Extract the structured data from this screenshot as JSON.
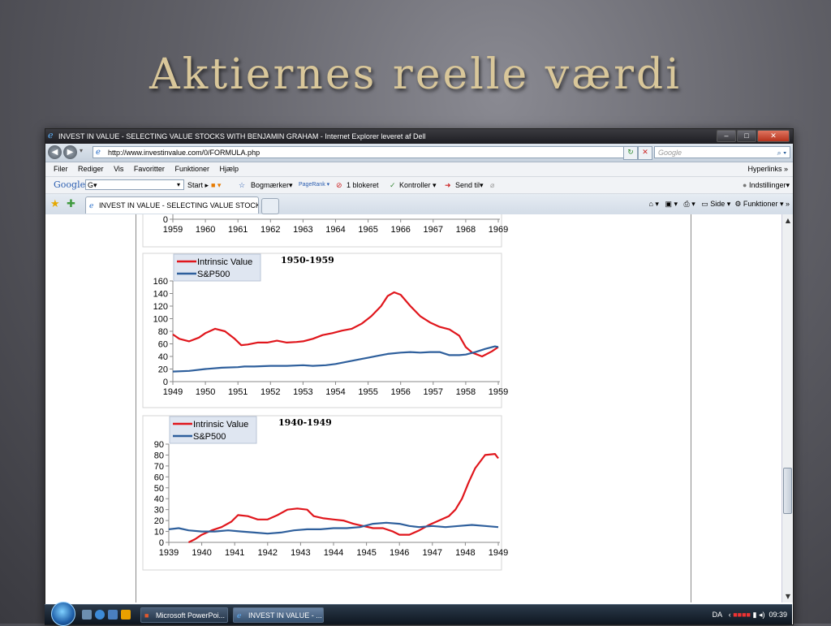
{
  "slide": {
    "title": "Aktiernes reelle værdi"
  },
  "browser": {
    "title": "INVEST IN VALUE - SELECTING VALUE STOCKS WITH BENJAMIN GRAHAM - Internet Explorer leveret af Dell",
    "url": "http://www.investinvalue.com/0/FORMULA.php",
    "search_placeholder": "Google",
    "menu": [
      "Filer",
      "Rediger",
      "Vis",
      "Favoritter",
      "Funktioner",
      "Hjælp"
    ],
    "hyperlinks": "Hyperlinks",
    "google_toolbar": {
      "brand": "Google",
      "box": "G▾",
      "start": "Start",
      "bookmarks": "Bogmærker▾",
      "pagerank": "PageRank",
      "blocked": "1 blokeret",
      "controls": "Kontroller",
      "send": "Send til▾",
      "settings": "Indstillinger▾"
    },
    "tab_label": "INVEST IN VALUE - SELECTING VALUE STOCKS W...",
    "command_bar": {
      "page": "Side",
      "tools": "Funktioner"
    }
  },
  "chart_data": [
    {
      "type": "line",
      "title": "",
      "x_tick_labels": [
        "1959",
        "1960",
        "1961",
        "1962",
        "1963",
        "1964",
        "1965",
        "1966",
        "1967",
        "1968",
        "1969"
      ],
      "y_tick_labels": [
        "0"
      ],
      "note": "partially visible, scrolled off top"
    },
    {
      "type": "line",
      "title": "1950-1959",
      "ylim": [
        0,
        160
      ],
      "y_ticks": [
        0,
        20,
        40,
        60,
        80,
        100,
        120,
        140,
        160
      ],
      "x_tick_labels": [
        "1949",
        "1950",
        "1951",
        "1952",
        "1953",
        "1954",
        "1955",
        "1956",
        "1957",
        "1958",
        "1959"
      ],
      "legend_position": "top-left",
      "series": [
        {
          "name": "Intrinsic Value",
          "color": "#e0161c",
          "x": [
            1949.0,
            1949.2,
            1949.5,
            1949.8,
            1950.0,
            1950.3,
            1950.6,
            1950.9,
            1951.1,
            1951.3,
            1951.6,
            1951.9,
            1952.2,
            1952.5,
            1952.8,
            1953.0,
            1953.3,
            1953.6,
            1953.9,
            1954.2,
            1954.5,
            1954.8,
            1955.1,
            1955.4,
            1955.6,
            1955.8,
            1956.0,
            1956.3,
            1956.6,
            1956.9,
            1957.2,
            1957.5,
            1957.8,
            1958.0,
            1958.2,
            1958.5,
            1958.8,
            1959.0
          ],
          "y": [
            75,
            68,
            64,
            70,
            77,
            84,
            80,
            68,
            58,
            59,
            62,
            62,
            65,
            62,
            63,
            64,
            68,
            74,
            77,
            81,
            84,
            92,
            104,
            120,
            136,
            142,
            138,
            120,
            104,
            94,
            87,
            83,
            73,
            55,
            46,
            40,
            48,
            55
          ]
        },
        {
          "name": "S&P500",
          "color": "#2e5f9c",
          "x": [
            1949.0,
            1949.5,
            1950.0,
            1950.5,
            1951.0,
            1951.2,
            1951.5,
            1952.0,
            1952.5,
            1953.0,
            1953.3,
            1953.7,
            1954.0,
            1954.4,
            1954.8,
            1955.0,
            1955.3,
            1955.6,
            1956.0,
            1956.3,
            1956.6,
            1956.9,
            1957.2,
            1957.5,
            1957.8,
            1958.0,
            1958.3,
            1958.6,
            1958.9,
            1959.0
          ],
          "y": [
            16,
            17,
            20,
            22,
            23,
            24,
            24,
            25,
            25,
            26,
            25,
            26,
            28,
            32,
            36,
            38,
            41,
            44,
            46,
            47,
            46,
            47,
            47,
            42,
            42,
            43,
            47,
            52,
            56,
            55
          ]
        }
      ]
    },
    {
      "type": "line",
      "title": "1940-1949",
      "ylim": [
        0,
        90
      ],
      "y_ticks": [
        0,
        10,
        20,
        30,
        40,
        50,
        60,
        70,
        80,
        90
      ],
      "x_tick_labels": [
        "1939",
        "1940",
        "1941",
        "1942",
        "1943",
        "1944",
        "1945",
        "1946",
        "1947",
        "1948",
        "1949"
      ],
      "legend_position": "top-left",
      "series": [
        {
          "name": "Intrinsic Value",
          "color": "#e0161c",
          "x": [
            1939.6,
            1939.8,
            1940.0,
            1940.3,
            1940.6,
            1940.9,
            1941.1,
            1941.4,
            1941.7,
            1942.0,
            1942.3,
            1942.6,
            1942.9,
            1943.2,
            1943.4,
            1943.7,
            1944.0,
            1944.3,
            1944.6,
            1944.9,
            1945.2,
            1945.5,
            1945.8,
            1946.0,
            1946.3,
            1946.6,
            1946.9,
            1947.2,
            1947.5,
            1947.7,
            1947.9,
            1948.1,
            1948.3,
            1948.6,
            1948.9,
            1949.0
          ],
          "y": [
            0,
            3,
            7,
            11,
            14,
            19,
            25,
            24,
            21,
            21,
            25,
            30,
            31,
            30,
            24,
            22,
            21,
            20,
            17,
            15,
            13,
            13,
            10,
            7,
            7,
            11,
            16,
            20,
            24,
            30,
            40,
            55,
            68,
            80,
            81,
            77
          ]
        },
        {
          "name": "S&P500",
          "color": "#2e5f9c",
          "x": [
            1939.0,
            1939.3,
            1939.6,
            1940.0,
            1940.4,
            1940.8,
            1941.2,
            1941.6,
            1942.0,
            1942.4,
            1942.8,
            1943.2,
            1943.6,
            1944.0,
            1944.4,
            1944.8,
            1945.2,
            1945.6,
            1946.0,
            1946.3,
            1946.6,
            1947.0,
            1947.4,
            1947.8,
            1948.2,
            1948.6,
            1949.0
          ],
          "y": [
            12,
            13,
            11,
            10,
            10,
            11,
            10,
            9,
            8,
            9,
            11,
            12,
            12,
            13,
            13,
            14,
            17,
            18,
            17,
            15,
            14,
            15,
            14,
            15,
            16,
            15,
            14
          ]
        }
      ]
    }
  ],
  "taskbar": {
    "tasks": [
      "Microsoft PowerPoi...",
      "INVEST IN VALUE - ..."
    ],
    "lang": "DA",
    "clock": "09:39"
  }
}
